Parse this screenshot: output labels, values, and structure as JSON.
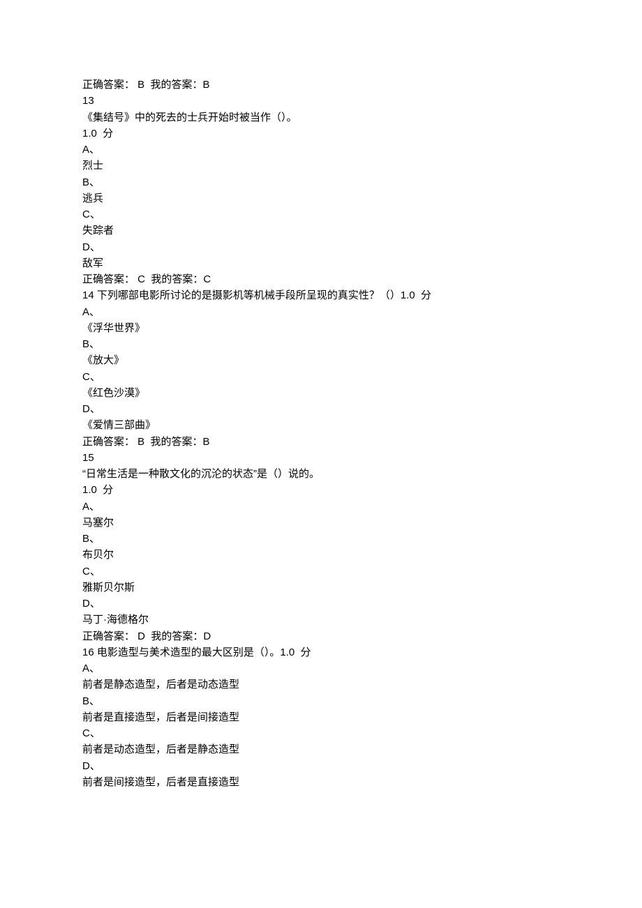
{
  "lines": [
    "正确答案： B  我的答案：B",
    "13",
    "《集结号》中的死去的士兵开始时被当作（）。",
    "1.0  分",
    "A、",
    "烈士",
    "B、",
    "逃兵",
    "C、",
    "失踪者",
    "D、",
    "敌军",
    "正确答案： C  我的答案：C",
    "14 下列哪部电影所讨论的是摄影机等机械手段所呈现的真实性？（）1.0  分",
    "A、",
    "《浮华世界》",
    "B、",
    "《放大》",
    "C、",
    "《红色沙漠》",
    "D、",
    "《爱情三部曲》",
    "正确答案： B  我的答案：B",
    "15",
    "“日常生活是一种散文化的沉沦的状态”是（）说的。",
    "1.0  分",
    "A、",
    "马塞尔",
    "B、",
    "布贝尔",
    "C、",
    "雅斯贝尔斯",
    "D、",
    "马丁·海德格尔",
    "正确答案： D  我的答案：D",
    "16 电影造型与美术造型的最大区别是（）。1.0  分",
    "A、",
    "前者是静态造型，后者是动态造型",
    "B、",
    "前者是直接造型，后者是间接造型",
    "C、",
    "前者是动态造型，后者是静态造型",
    "D、",
    "前者是间接造型，后者是直接造型"
  ]
}
